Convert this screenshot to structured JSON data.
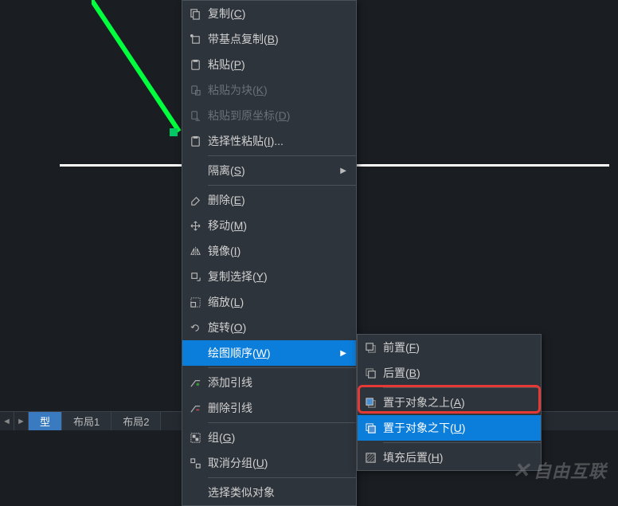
{
  "tabs": {
    "partial": "型",
    "layout1": "布局1",
    "layout2": "布局2"
  },
  "menu": {
    "copy": "复制(C)",
    "copyBase": "带基点复制(B)",
    "paste": "粘贴(P)",
    "pasteBlock": "粘贴为块(K)",
    "pasteOrig": "粘贴到原坐标(D)",
    "pasteSpecial": "选择性粘贴(I)...",
    "isolate": "隔离(S)",
    "delete": "删除(E)",
    "move": "移动(M)",
    "mirror": "镜像(I)",
    "copySelect": "复制选择(Y)",
    "scale": "缩放(L)",
    "rotate": "旋转(O)",
    "drawOrder": "绘图顺序(W)",
    "addLeader": "添加引线",
    "removeLeader": "删除引线",
    "group": "组(G)",
    "ungroup": "取消分组(U)",
    "selectSimilar": "选择类似对象"
  },
  "submenu": {
    "front": "前置(F)",
    "back": "后置(B)",
    "aboveObj": "置于对象之上(A)",
    "belowObj": "置于对象之下(U)",
    "hatchBack": "填充后置(H)"
  },
  "watermark": "自由互联"
}
